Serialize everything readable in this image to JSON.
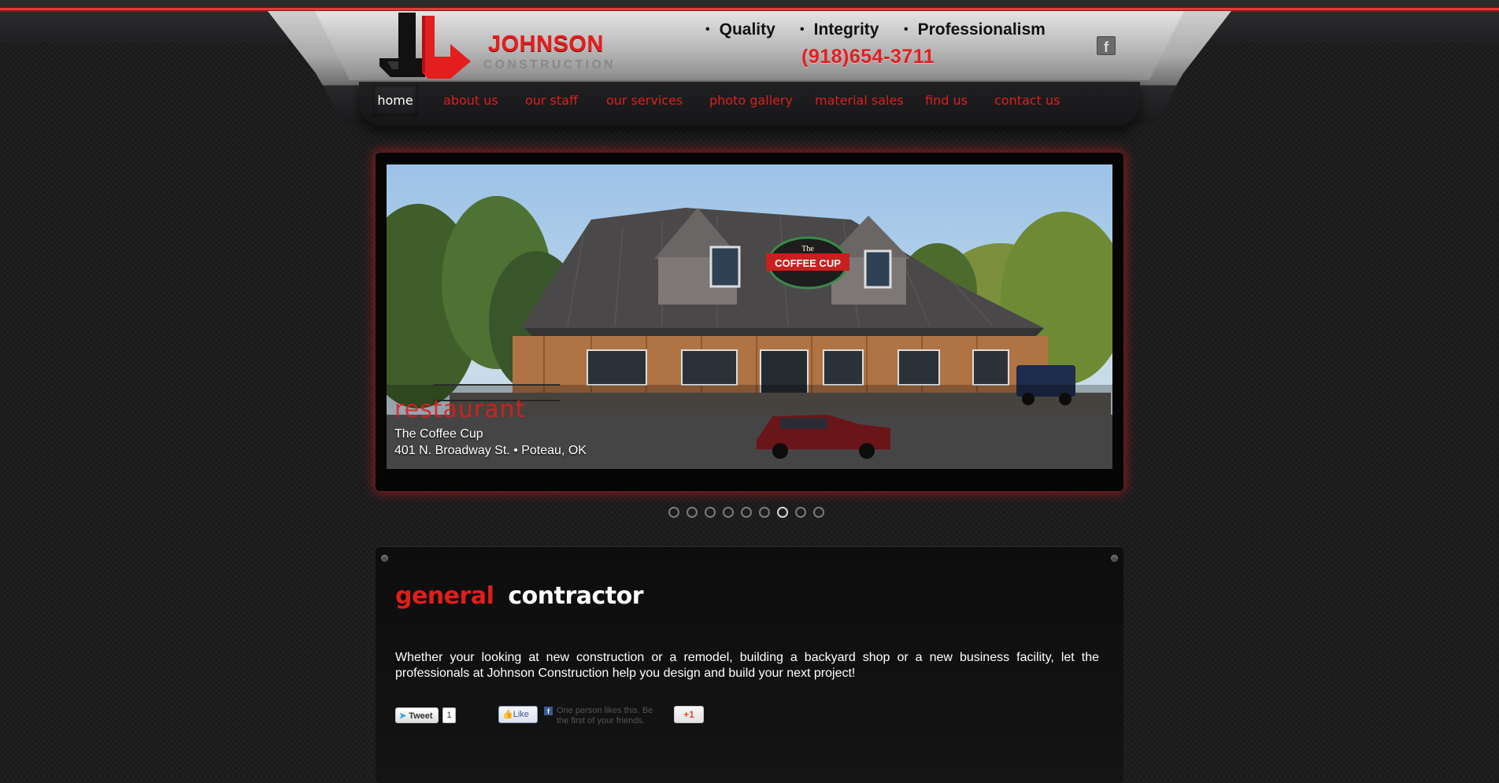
{
  "brand": {
    "name": "JOHNSON",
    "sub": "CONSTRUCTION"
  },
  "tagline": [
    "Quality",
    "Integrity",
    "Professionalism"
  ],
  "phone": "(918)654-3711",
  "social_header": {
    "facebook_glyph": "f"
  },
  "nav": [
    {
      "label": "home",
      "active": true
    },
    {
      "label": "about us"
    },
    {
      "label": "our staff"
    },
    {
      "label": "our services"
    },
    {
      "label": "photo gallery"
    },
    {
      "label": "material sales"
    },
    {
      "label": "find us"
    },
    {
      "label": "contact us"
    }
  ],
  "slide": {
    "category": "restaurant",
    "name": "The Coffee Cup",
    "address": "401 N. Broadway St. • Poteau, OK",
    "sign_text": "COFFEE CUP",
    "sign_top": "The"
  },
  "slider_dots": {
    "count": 9,
    "active_index": 6
  },
  "content": {
    "heading_red": "general",
    "heading_white": "contractor",
    "intro": "Whether your looking at new construction or a remodel, building a backyard shop or a new business facility, let the professionals at Johnson Construction help you design and build your next project!"
  },
  "social": {
    "tweet_label": "Tweet",
    "tweet_count": "1",
    "like_label": "Like",
    "like_text": "One person likes this. Be the first of your friends.",
    "gplus_label": "+1"
  },
  "colors": {
    "accent": "#e21d1d",
    "background": "#1d1d1f"
  }
}
